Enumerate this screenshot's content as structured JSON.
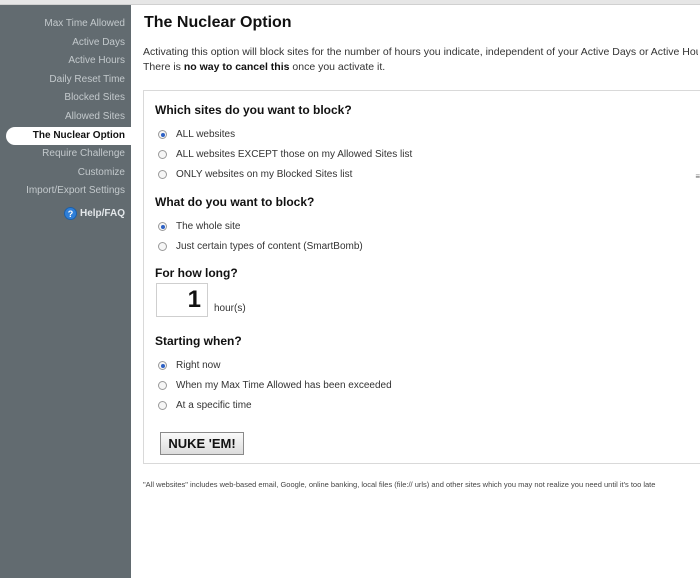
{
  "sidebar": {
    "items": [
      {
        "label": "Max Time Allowed",
        "active": false
      },
      {
        "label": "Active Days",
        "active": false
      },
      {
        "label": "Active Hours",
        "active": false
      },
      {
        "label": "Daily Reset Time",
        "active": false
      },
      {
        "label": "Blocked Sites",
        "active": false
      },
      {
        "label": "Allowed Sites",
        "active": false
      },
      {
        "label": "The Nuclear Option",
        "active": true
      },
      {
        "label": "Require Challenge",
        "active": false
      },
      {
        "label": "Customize",
        "active": false
      },
      {
        "label": "Import/Export Settings",
        "active": false
      }
    ],
    "help": {
      "icon": "?",
      "label": "Help/FAQ"
    }
  },
  "main": {
    "title": "The Nuclear Option",
    "intro_line1": "Activating this option will block sites for the number of hours you indicate, independent of your Active Days or Active Hours",
    "intro_line2_pre": "There is ",
    "intro_line2_bold": "no way to cancel this",
    "intro_line2_post": " once you activate it.",
    "sections": {
      "sites": {
        "heading": "Which sites do you want to block?",
        "options": [
          {
            "label": "ALL websites",
            "checked": true
          },
          {
            "label": "ALL websites EXCEPT those on my Allowed Sites list",
            "checked": false
          },
          {
            "label": "ONLY websites on my Blocked Sites list",
            "checked": false
          }
        ]
      },
      "what": {
        "heading": "What do you want to block?",
        "options": [
          {
            "label": "The whole site",
            "checked": true
          },
          {
            "label": "Just certain types of content (SmartBomb)",
            "checked": false
          }
        ]
      },
      "duration": {
        "heading": "For how long?",
        "value": "1",
        "unit": "hour(s)"
      },
      "start": {
        "heading": "Starting when?",
        "options": [
          {
            "label": "Right now",
            "checked": true
          },
          {
            "label": "When my Max Time Allowed has been exceeded",
            "checked": false
          },
          {
            "label": "At a specific time",
            "checked": false
          }
        ]
      }
    },
    "submit_label": "NUKE 'EM!",
    "footnote": "\"All websites\" includes web-based email, Google, online banking, local files (file:// urls) and other sites which you may not realize you need until it's too late",
    "edge_mark": "≡"
  }
}
